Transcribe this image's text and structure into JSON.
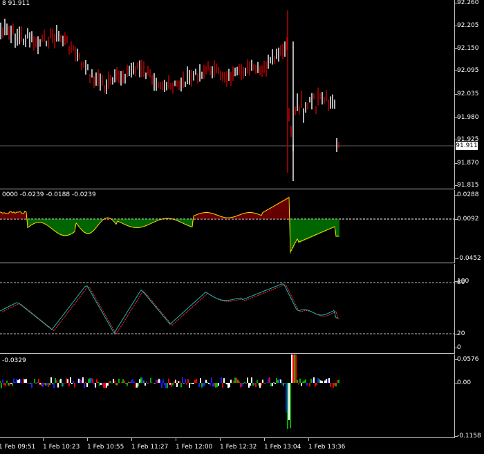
{
  "price_pane": {
    "label": "8 91.911",
    "scale": [
      "92.260",
      "92.205",
      "92.150",
      "92.095",
      "92.035",
      "91.980",
      "91.925",
      "91.870",
      "91.815"
    ],
    "current_price": "91.911",
    "colors": {
      "bull": "#ffffff",
      "bear": "#cc0000",
      "grid": "#c0c0c0"
    }
  },
  "macd_pane": {
    "label": "0000 -0.0239 -0.0188 -0.0239",
    "scale": [
      "0.0288",
      "0.0092",
      "-0.0452"
    ],
    "colors": {
      "up": "#00cc00",
      "down": "#cc0000",
      "signal": "#ffd700"
    }
  },
  "stoch_pane": {
    "label": "",
    "scale": [
      "100",
      "80",
      "20",
      "0"
    ],
    "colors": {
      "main": "#1fb5b5",
      "signal": "#ff3030"
    }
  },
  "osc_pane": {
    "label": "-0.0329",
    "scale": [
      "0.0576",
      "0.00",
      "-0.1158"
    ],
    "colors": {
      "up": "#ffffff",
      "blue": "#1e1eff",
      "red": "#ff0000",
      "green": "#00b000"
    }
  },
  "time_axis": [
    "1 Feb 09:51",
    "1 Feb 10:23",
    "1 Feb 10:55",
    "1 Feb 11:27",
    "1 Feb 12:00",
    "1 Feb 12:32",
    "1 Feb 13:04",
    "1 Feb 13:36"
  ]
}
